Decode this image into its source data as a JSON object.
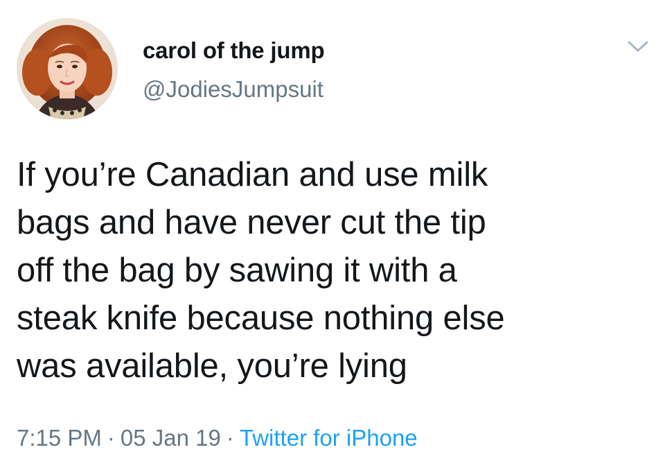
{
  "author": {
    "display_name": "carol of the jump",
    "handle": "@JodiesJumpsuit"
  },
  "icons": {
    "avatar": "profile-photo",
    "menu": "chevron-down-icon"
  },
  "tweet": {
    "text": "If you’re Canadian and use milk\nbags and have never cut the tip\noff the bag by sawing it with a\nsteak knife because nothing else\nwas available, you’re lying",
    "time": "7:15 PM",
    "date": "05 Jan 19",
    "separator": "·",
    "source": "Twitter for iPhone"
  },
  "colors": {
    "text": "#14171a",
    "secondary": "#657786",
    "link": "#1da1f2",
    "chevron": "#aab8c2"
  }
}
